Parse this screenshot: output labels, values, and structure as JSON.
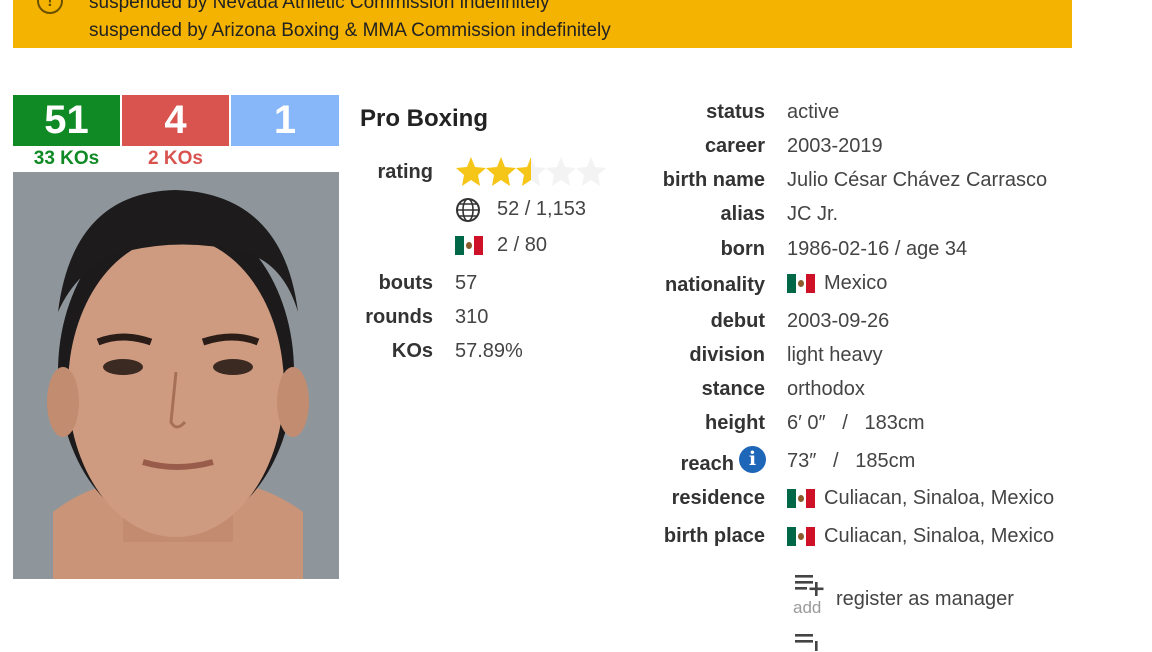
{
  "banner": {
    "line1": "suspended by Nevada Athletic Commission indefinitely",
    "line2": "suspended by Arizona Boxing & MMA Commission indefinitely",
    "icon": "warning-icon"
  },
  "record": {
    "wins": "51",
    "losses": "4",
    "draws": "1",
    "win_kos": "33 KOs",
    "loss_kos": "2 KOs",
    "colors": {
      "win": "#0f8a25",
      "loss": "#d9534f",
      "draw": "#87b7f8"
    }
  },
  "pro": {
    "title": "Pro Boxing",
    "rating_label": "rating",
    "rating_stars": 2.5,
    "rating_max": 5,
    "world_rank": "52 / 1,153",
    "country_rank": "2 / 80",
    "bouts_label": "bouts",
    "bouts": "57",
    "rounds_label": "rounds",
    "rounds": "310",
    "kos_label": "KOs",
    "kos": "57.89%"
  },
  "details": {
    "status_label": "status",
    "status": "active",
    "career_label": "career",
    "career": "2003-2019",
    "birth_name_label": "birth name",
    "birth_name": "Julio César Chávez Carrasco",
    "alias_label": "alias",
    "alias": "JC Jr.",
    "born_label": "born",
    "born": "1986-02-16 / age 34",
    "nationality_label": "nationality",
    "nationality": "Mexico",
    "debut_label": "debut",
    "debut": "2003-09-26",
    "division_label": "division",
    "division": "light heavy",
    "stance_label": "stance",
    "stance": "orthodox",
    "height_label": "height",
    "height": "6′ 0″   /   183cm",
    "reach_label": "reach",
    "reach": "73″   /   185cm",
    "residence_label": "residence",
    "residence": "Culiacan, Sinaloa, Mexico",
    "birth_place_label": "birth place",
    "birth_place": "Culiacan, Sinaloa, Mexico"
  },
  "actions": {
    "add_word": "add",
    "register_manager": "register as manager"
  }
}
